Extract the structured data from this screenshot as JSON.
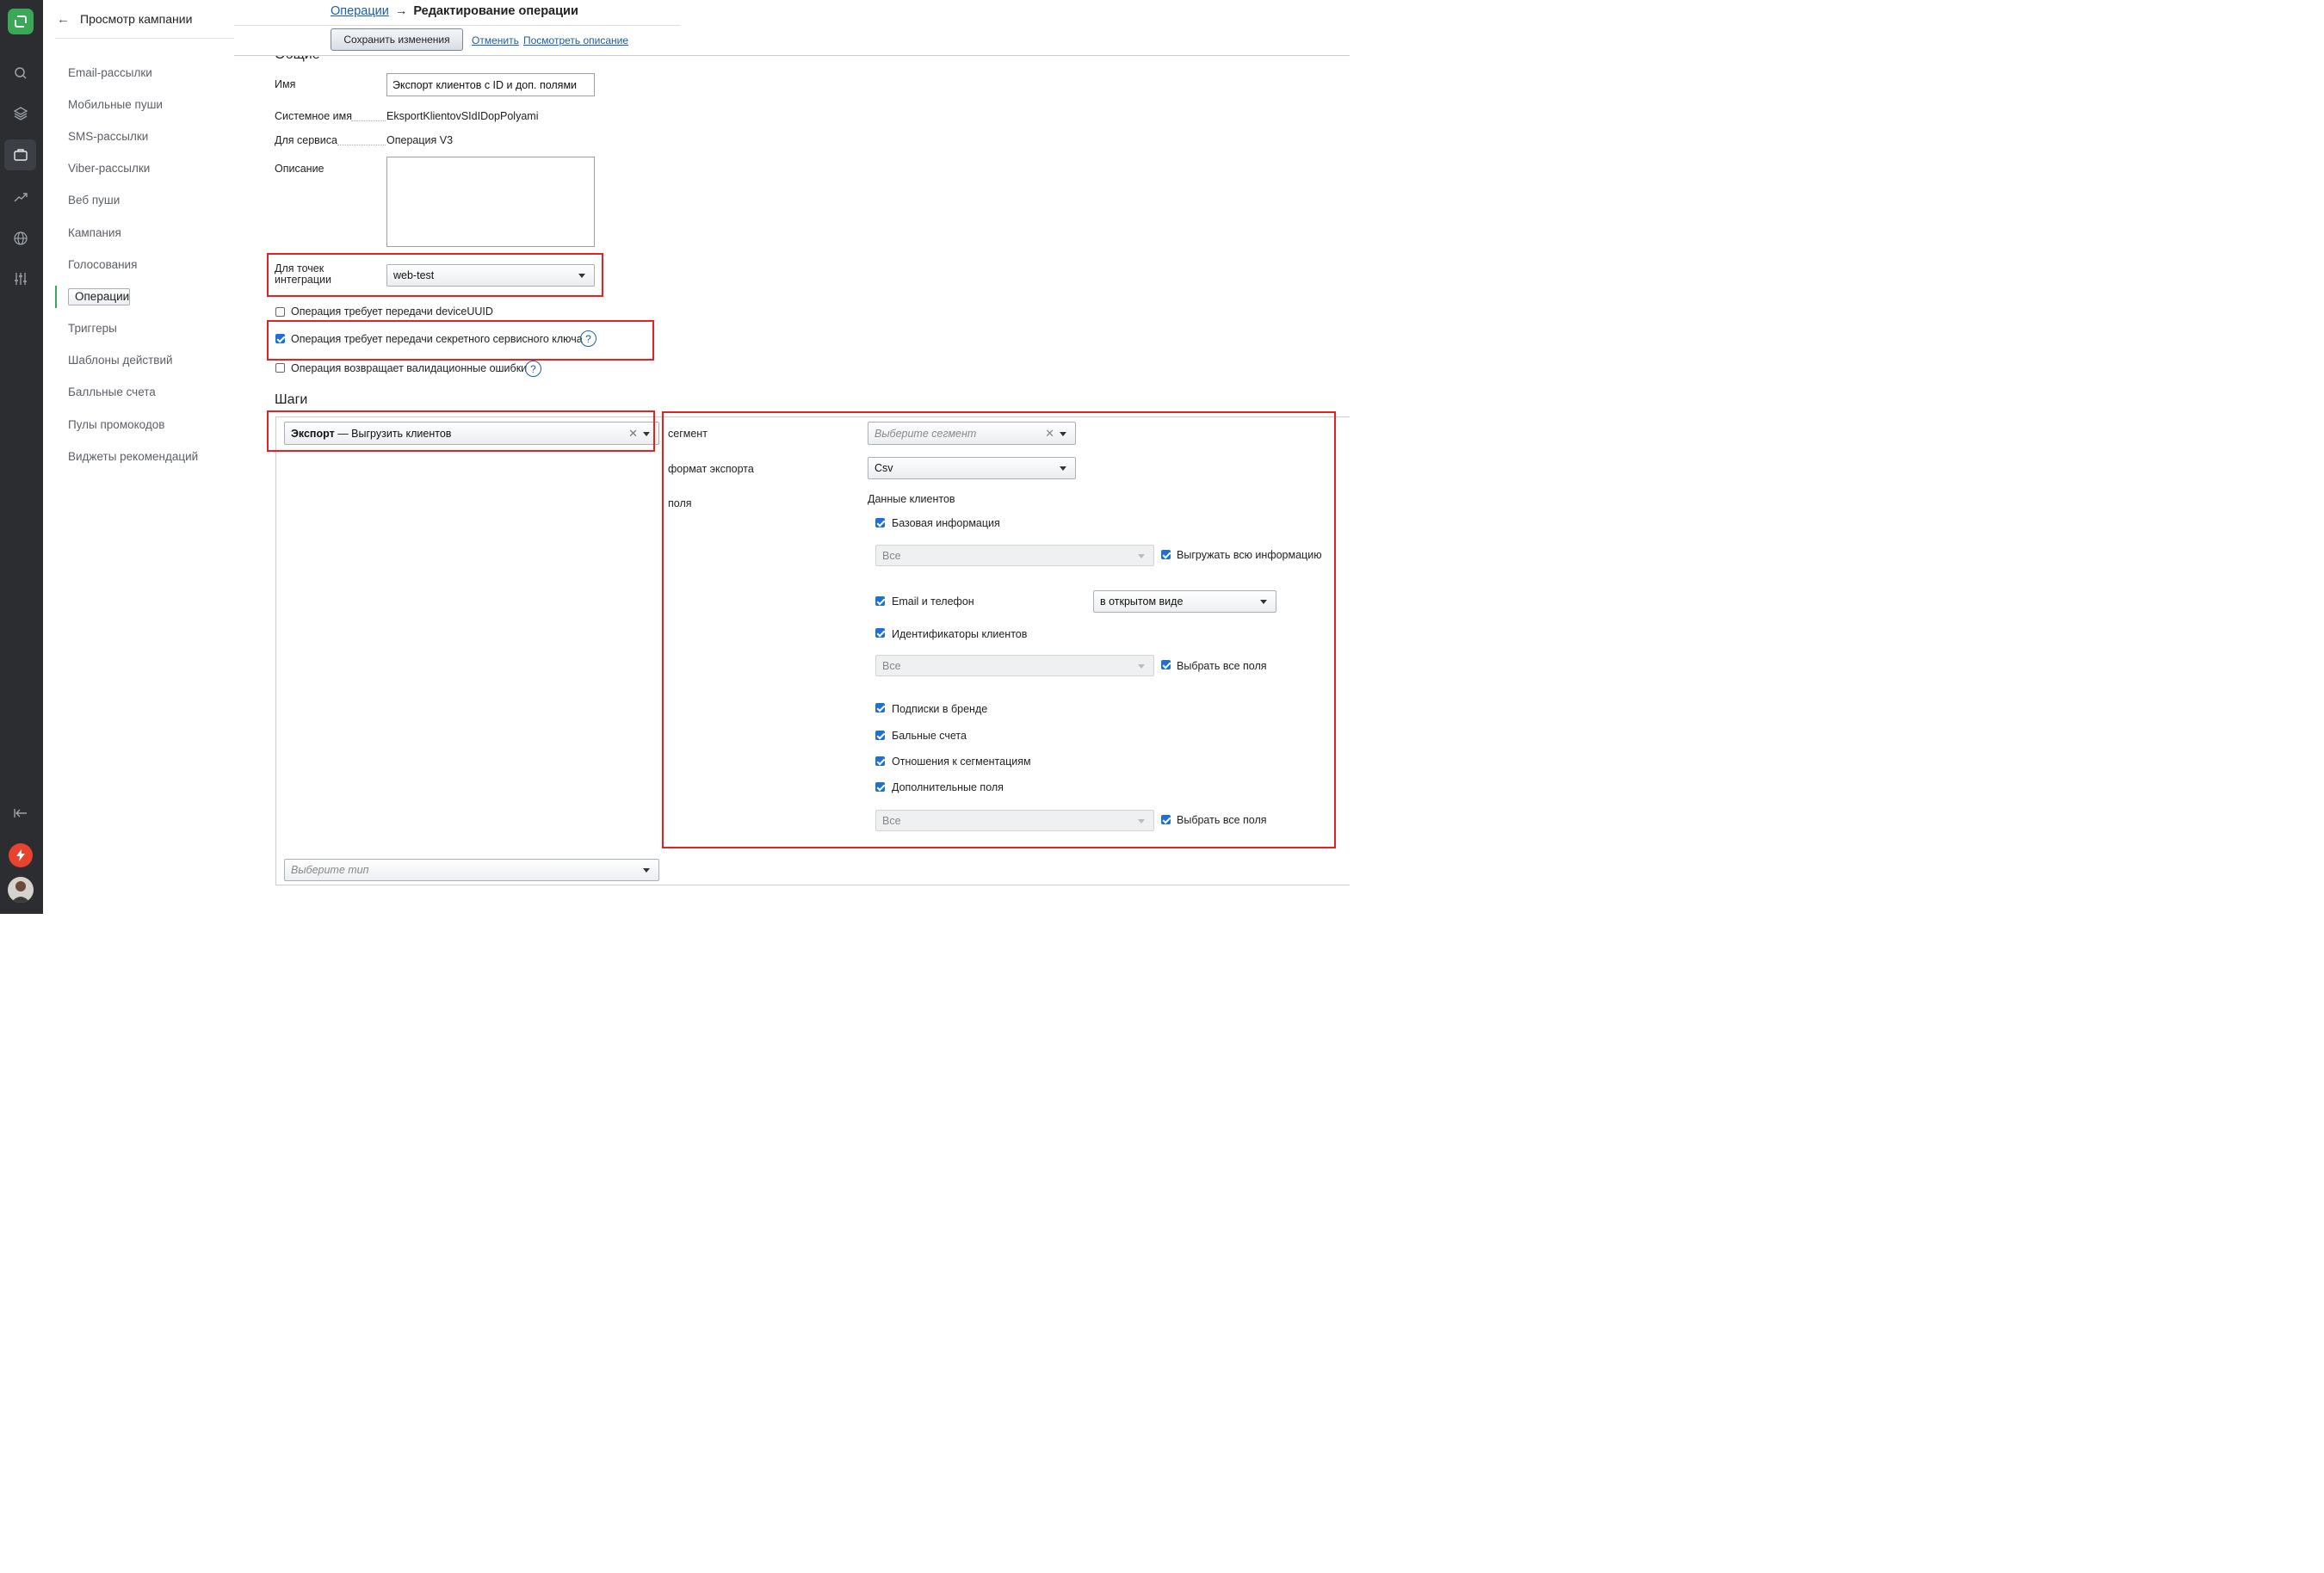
{
  "rail": {
    "icons": [
      "app-logo",
      "search-icon",
      "layers-icon",
      "briefcase-icon",
      "trend-icon",
      "globe-icon",
      "sliders-icon",
      "collapse-icon",
      "bolt-icon",
      "avatar"
    ]
  },
  "sidenav": {
    "back_title": "Просмотр кампании",
    "items": [
      "Email-рассылки",
      "Мобильные пуши",
      "SMS-рассылки",
      "Viber-рассылки",
      "Веб пуши",
      "Кампания",
      "Голосования",
      "Операции",
      "Триггеры",
      "Шаблоны действий",
      "Балльные счета",
      "Пулы промокодов",
      "Виджеты рекомендаций"
    ],
    "selected": "Операции",
    "accent": "#3aa856"
  },
  "breadcrumb": {
    "parent": "Операции",
    "arrow": "→",
    "current": "Редактирование операции"
  },
  "toolbar": {
    "save": "Сохранить изменения",
    "cancel": "Отменить",
    "view_description": "Посмотреть описание"
  },
  "general": {
    "section_title": "Общие",
    "name_label": "Имя",
    "name_value": "Экспорт клиентов с ID и доп. полями",
    "sysname_label": "Системное имя",
    "sysname_value": "EksportKlientovSIdIDopPolyami",
    "service_label": "Для сервиса",
    "service_value": "Операция V3",
    "desc_label": "Описание",
    "desc_value": "",
    "points_label_1": "Для точек",
    "points_label_2": "интеграции",
    "points_value": "web-test",
    "cb_device": "Операция требует передачи deviceUUID",
    "cb_secret": "Операция требует передачи секретного сервисного ключа",
    "cb_validation": "Операция возвращает валидационные ошибки",
    "help": "?"
  },
  "steps": {
    "title": "Шаги",
    "step_bold": "Экспорт",
    "step_rest": " — Выгрузить клиентов",
    "add_type_placeholder": "Выберите тип",
    "segment_label": "сегмент",
    "segment_placeholder": "Выберите сегмент",
    "format_label": "формат экспорта",
    "format_value": "Csv",
    "fields_label": "поля",
    "customer_data": "Данные клиентов",
    "basic_info": "Базовая информация",
    "all": "Все",
    "export_all_info": "Выгружать всю информацию",
    "email_phone": "Email и телефон",
    "email_mode": "в открытом виде",
    "identifiers": "Идентификаторы клиентов",
    "select_all_fields": "Выбрать все поля",
    "subscriptions": "Подписки в бренде",
    "balances": "Бальные счета",
    "segmentations": "Отношения к сегментациям",
    "extra_fields": "Дополнительные поля"
  },
  "colors": {
    "link": "#1a5ea8",
    "checkbox": "#1e6fd9",
    "highlight": "#e52222",
    "rail": "#2b2d31"
  }
}
